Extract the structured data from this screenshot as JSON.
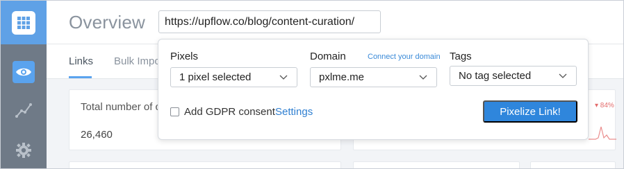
{
  "header": {
    "title": "Overview",
    "url_value": "https://upflow.co/blog/content-curation/"
  },
  "tabs": [
    {
      "label": "Links"
    },
    {
      "label": "Bulk Impo"
    }
  ],
  "cards": {
    "total_label": "Total number of c",
    "total_value": "26,460",
    "trend_badge": "▾ 84%"
  },
  "popover": {
    "pixels_label": "Pixels",
    "pixels_selected": "1 pixel selected",
    "domain_label": "Domain",
    "connect_domain_link": "Connect your domain",
    "domain_selected": "pxlme.me",
    "tags_label": "Tags",
    "tags_selected": "No tag selected",
    "gdpr_label": "Add GDPR consent",
    "settings_link": "Settings",
    "submit_label": "Pixelize Link!"
  },
  "colors": {
    "accent": "#2f86dc",
    "sidebar": "#6f7a87",
    "logo_bg": "#5fa1e6"
  },
  "icons": [
    "grid-logo-icon",
    "eye-icon",
    "analytics-icon",
    "gear-icon",
    "chevron-down-icon"
  ]
}
